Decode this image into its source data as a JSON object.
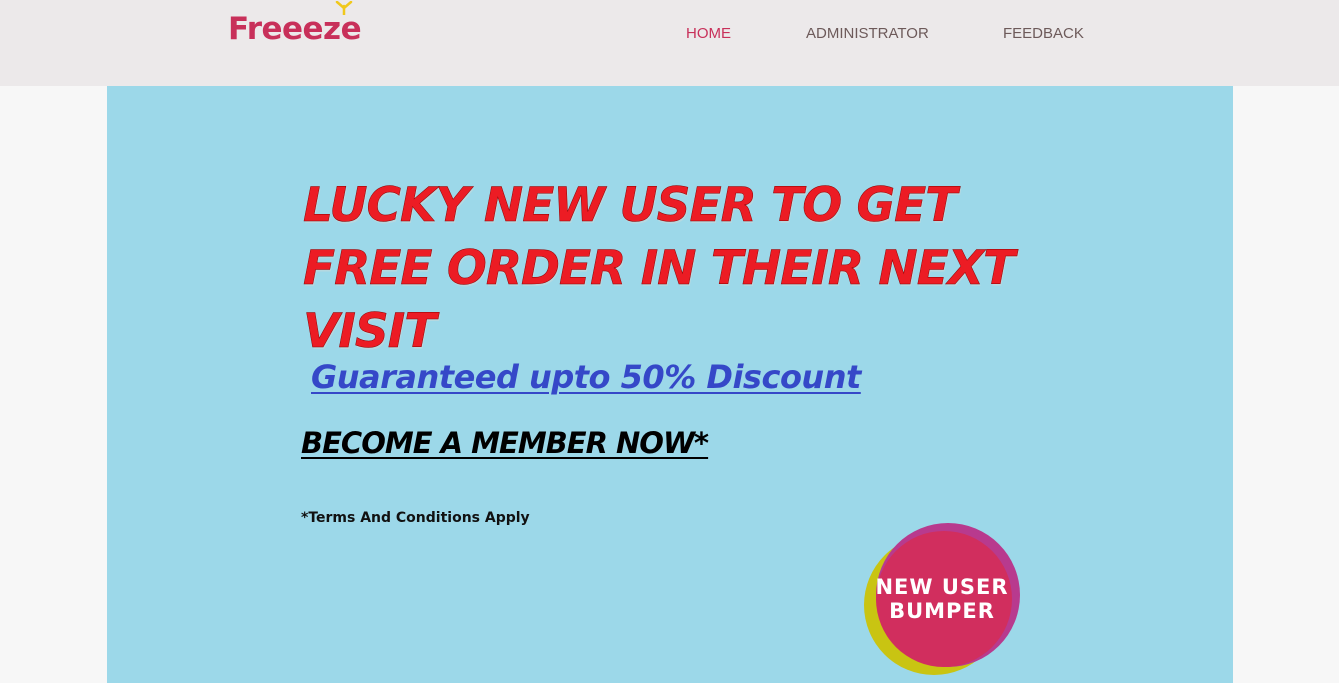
{
  "brand": {
    "name": "Freeeze",
    "color": "#c8305a",
    "sprout_color": "#f0c81c",
    "icon": "sprout-icon"
  },
  "nav": {
    "items": [
      {
        "label": "HOME",
        "active": true
      },
      {
        "label": "ADMINISTRATOR",
        "active": false
      },
      {
        "label": "FEEDBACK",
        "active": false
      }
    ],
    "active_color": "#c8305a",
    "color": "#6d5a5a"
  },
  "banner": {
    "background": "#9cd8e9",
    "headline": "LUCKY NEW USER TO GET FREE ORDER IN THEIR NEXT VISIT",
    "headline_color": "#ec1c24",
    "discount": "Guaranteed upto 50% Discount",
    "discount_color": "#3548c8",
    "cta": "BECOME A MEMBER NOW*",
    "terms": "*Terms And Conditions Apply",
    "badge": {
      "line1": "NEW USER",
      "line2": "BUMPER",
      "colors": [
        "#c9c412",
        "#b83a8e",
        "#d12e5e"
      ]
    }
  }
}
